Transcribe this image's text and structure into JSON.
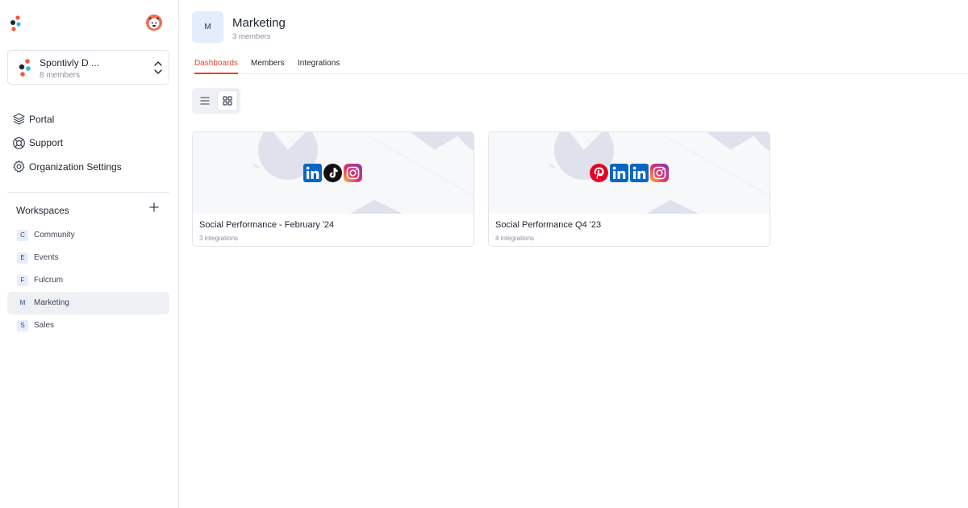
{
  "sidebar": {
    "org": {
      "name": "Spontivly D ...",
      "members": "8 members"
    },
    "nav": [
      {
        "label": "Portal",
        "icon": "layers-icon"
      },
      {
        "label": "Support",
        "icon": "lifebuoy-icon"
      },
      {
        "label": "Organization Settings",
        "icon": "gear-icon"
      }
    ],
    "workspaces_title": "Workspaces",
    "workspaces": [
      {
        "initial": "C",
        "label": "Community"
      },
      {
        "initial": "E",
        "label": "Events"
      },
      {
        "initial": "F",
        "label": "Fulcrum"
      },
      {
        "initial": "M",
        "label": "Marketing",
        "active": true
      },
      {
        "initial": "S",
        "label": "Sales"
      }
    ]
  },
  "header": {
    "initial": "M",
    "title": "Marketing",
    "members": "3 members"
  },
  "tabs": [
    {
      "label": "Dashboards",
      "active": true
    },
    {
      "label": "Members"
    },
    {
      "label": "Integrations"
    }
  ],
  "dashboards": [
    {
      "title": "Social Performance - February '24",
      "subtitle": "3 integrations",
      "icons": [
        "linkedin-icon",
        "tiktok-icon",
        "instagram-icon"
      ]
    },
    {
      "title": "Social Performance Q4 '23",
      "subtitle": "4 integrations",
      "icons": [
        "pinterest-icon",
        "linkedin-icon",
        "linkedin-icon",
        "instagram-icon"
      ]
    }
  ],
  "colors": {
    "accent": "#e0472b",
    "linkedin": "#0a66c2",
    "pinterest": "#e60023"
  }
}
